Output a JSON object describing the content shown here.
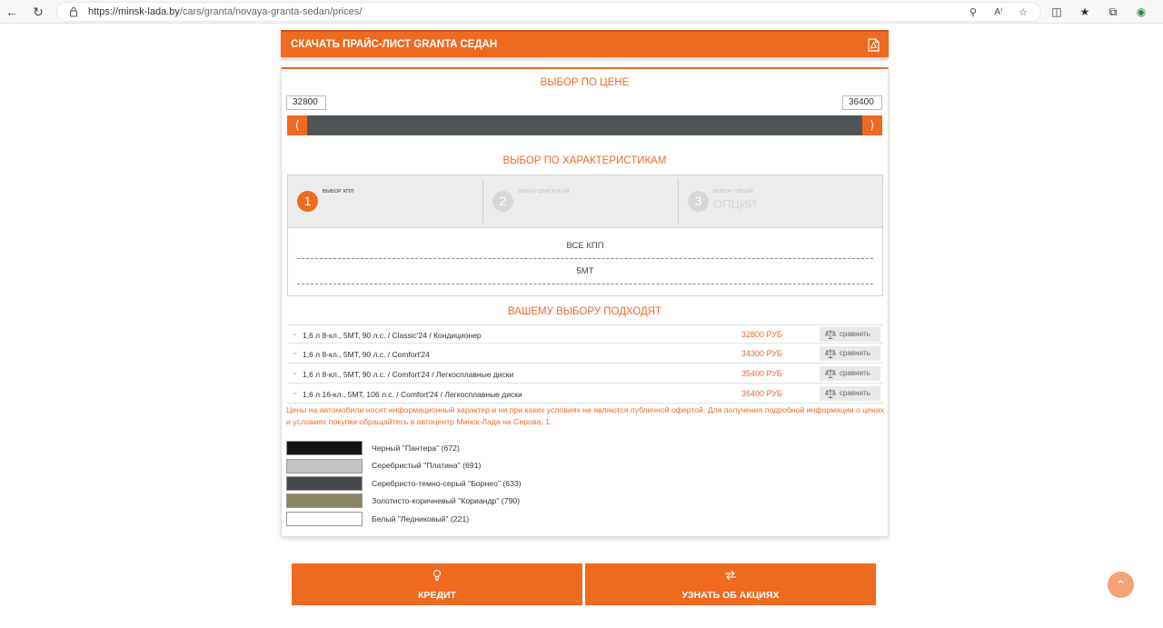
{
  "browser": {
    "url_host": "https://minsk-lada.by",
    "url_path": "/cars/granta/novaya-granta-sedan/prices/"
  },
  "download": {
    "label": "СКАЧАТЬ ПРАЙС-ЛИСТ GRANTA СЕДАН"
  },
  "price_filter": {
    "title": "ВЫБОР ПО ЦЕНЕ",
    "min": "32800",
    "max": "36400"
  },
  "char_filter": {
    "title": "ВЫБОР ПО ХАРАКТЕРИСТИКАМ",
    "steps": [
      {
        "num": "1",
        "small": "ВЫБОР КПП",
        "big": ""
      },
      {
        "num": "2",
        "small": "ВЫБОР ДВИГАТЕЛЯ",
        "big": ""
      },
      {
        "num": "3",
        "small": "ВЫБОР ОПЦИЙ",
        "big": "ОПЦИИ"
      }
    ],
    "options": [
      "ВСЕ КПП",
      "5МТ"
    ]
  },
  "results": {
    "title": "ВАШЕМУ ВЫБОРУ ПОДХОДЯТ",
    "compare_label": "сравнить",
    "rows": [
      {
        "desc": "1,6 л 8-кл., 5МТ, 90 л.с. / Classic'24 / Кондиционер",
        "price": "32800 РУБ"
      },
      {
        "desc": "1,6 л 8-кл., 5МТ, 90 л.с. / Comfort'24",
        "price": "34300 РУБ"
      },
      {
        "desc": "1,6 л 8-кл., 5МТ, 90 л.с. / Comfort'24 / Легкосплавные диски",
        "price": "35400 РУБ"
      },
      {
        "desc": "1,6 л 16-кл., 5МТ, 106 л.с. / Comfort'24 / Легкосплавные диски",
        "price": "36400 РУБ"
      }
    ],
    "note": "Цены на автомобили носят информационный характер и ни при каких условиях не являются публичной офертой. Для получения подробной информации о ценах и условиях покупки обращайтесь в автоцентр Минск-Лада на Серова, 1."
  },
  "colors": [
    {
      "name": "Черный \"Пантера\" (672)",
      "hex": "#161312"
    },
    {
      "name": "Серебристый \"Платина\" (691)",
      "hex": "#c3c3c3"
    },
    {
      "name": "Серебристо-темно-серый \"Борнео\" (633)",
      "hex": "#45494b"
    },
    {
      "name": "Золотисто-коричневый \"Кориандр\" (790)",
      "hex": "#8a8565"
    },
    {
      "name": "Белый \"Ледниковый\" (221)",
      "hex": "#ffffff"
    }
  ],
  "bottom": {
    "credit": "КРЕДИТ",
    "promo": "УЗНАТЬ ОБ АКЦИЯХ"
  },
  "theme": {
    "accent": "#ee6a1f",
    "slider": "#4f5457"
  }
}
